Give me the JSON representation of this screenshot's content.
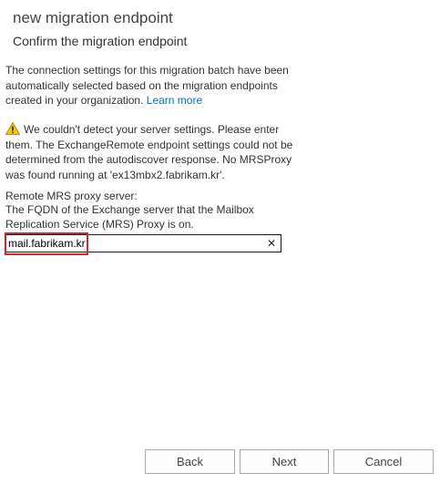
{
  "dialog": {
    "title": "new migration endpoint",
    "subtitle": "Confirm the migration endpoint"
  },
  "intro": {
    "text": "The connection settings for this migration batch have been automatically selected based on the migration endpoints created in your organization.",
    "link_label": "Learn more"
  },
  "warning": {
    "icon": "warning-triangle-icon",
    "text": "We couldn't detect your server settings. Please enter them. The ExchangeRemote endpoint settings could not be determined from the autodiscover response. No MRSProxy was found running at 'ex13mbx2.fabrikam.kr'."
  },
  "mrs_proxy_field": {
    "label": "Remote MRS proxy server:",
    "description": "The FQDN of the Exchange server that the Mailbox Replication Service (MRS) Proxy is on.",
    "value": "mail.fabrikam.kr",
    "clear_label": "✕"
  },
  "buttons": {
    "back": "Back",
    "next": "Next",
    "cancel": "Cancel"
  },
  "colors": {
    "link": "#0072c6",
    "highlight": "#d6262f",
    "warning_fill": "#f5c518"
  }
}
